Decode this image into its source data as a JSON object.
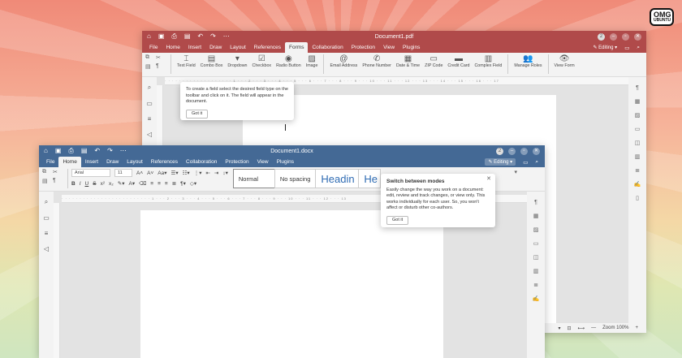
{
  "logo": {
    "text": "OMG",
    "sub": "UBUNTU"
  },
  "back_window": {
    "title": "Document1.pdf",
    "avatar": "2",
    "menu": [
      "File",
      "Home",
      "Insert",
      "Draw",
      "Layout",
      "References",
      "Forms",
      "Collaboration",
      "Protection",
      "View",
      "Plugins"
    ],
    "active_menu": "Forms",
    "editing": "Editing",
    "ribbon": [
      {
        "icon": "⌶",
        "label": "Text Field"
      },
      {
        "icon": "▤",
        "label": "Combo Box"
      },
      {
        "icon": "▾",
        "label": "Dropdown"
      },
      {
        "icon": "☑",
        "label": "Checkbox"
      },
      {
        "icon": "◉",
        "label": "Radio Button"
      },
      {
        "icon": "▨",
        "label": "Image"
      },
      {
        "icon": "@",
        "label": "Email Address"
      },
      {
        "icon": "✆",
        "label": "Phone Number"
      },
      {
        "icon": "▦",
        "label": "Date & Time"
      },
      {
        "icon": "▭",
        "label": "ZIP Code"
      },
      {
        "icon": "▬",
        "label": "Credit Card"
      },
      {
        "icon": "▥",
        "label": "Complex Field"
      },
      {
        "icon": "👥",
        "label": "Manage Roles"
      },
      {
        "icon": "👁",
        "label": "View Form"
      }
    ],
    "tip": {
      "text": "To create a field select the desired field type on the toolbar and click on it. The field will appear in the document.",
      "button": "Got it"
    },
    "status": {
      "zoom": "Zoom 100%"
    }
  },
  "front_window": {
    "title": "Document1.docx",
    "avatar": "2",
    "menu": [
      "File",
      "Home",
      "Insert",
      "Draw",
      "Layout",
      "References",
      "Collaboration",
      "Protection",
      "View",
      "Plugins"
    ],
    "active_menu": "Home",
    "editing": "Editing",
    "font": "Arial",
    "size": "11",
    "styles": [
      "Normal",
      "No spacing",
      "Headin",
      "He"
    ],
    "tip": {
      "title": "Switch between modes",
      "text": "Easily change the way you work on a document: edit, review and track changes, or view only. This works individually for each user. So, you won't affect or disturb other co-authors.",
      "button": "Got it"
    }
  }
}
